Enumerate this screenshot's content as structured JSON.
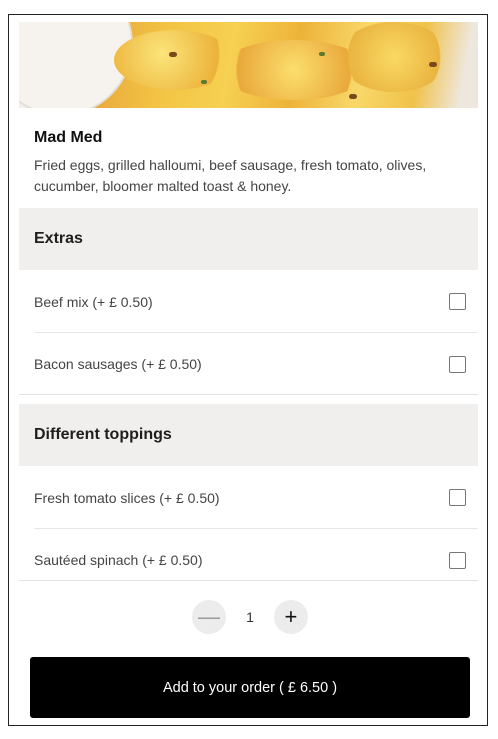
{
  "item": {
    "name": "Mad Med",
    "description": "Fried eggs, grilled halloumi, beef sausage, fresh tomato, olives, cucumber, bloomer malted toast & honey."
  },
  "sections": [
    {
      "title": "Extras",
      "options": [
        {
          "label": "Beef mix (+ £ 0.50)",
          "checked": false
        },
        {
          "label": "Bacon sausages (+ £ 0.50)",
          "checked": false
        }
      ]
    },
    {
      "title": "Different toppings",
      "options": [
        {
          "label": "Fresh tomato slices (+ £ 0.50)",
          "checked": false
        },
        {
          "label": "Sautéed spinach (+ £ 0.50)",
          "checked": false
        }
      ]
    }
  ],
  "quantity": {
    "value": "1",
    "minus_symbol": "—",
    "plus_symbol": "+"
  },
  "cta": {
    "label": "Add to your order ( £ 6.50 )"
  },
  "colors": {
    "cta_background": "#000000",
    "section_header_background": "#f1efed"
  }
}
